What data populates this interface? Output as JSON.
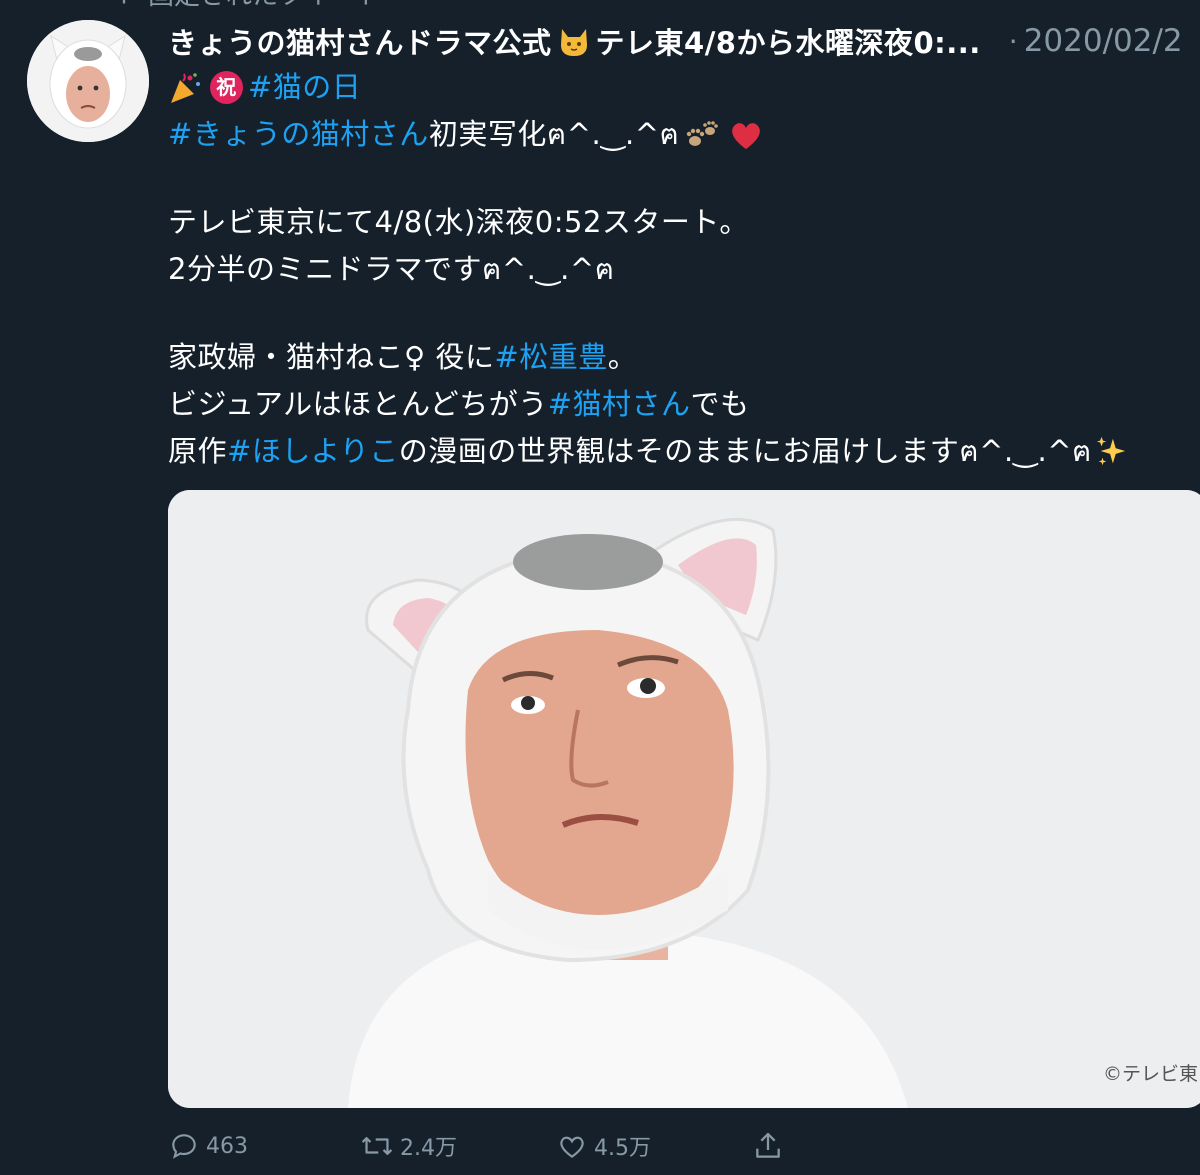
{
  "pinned_label": "固定されたツイート",
  "tweet": {
    "display_name": "きょうの猫村さんドラマ公式",
    "display_name_rest": "テレ東4/8から水曜深夜0:...",
    "separator": "·",
    "date": "2020/02/2",
    "lines": {
      "l1_badge": "祝",
      "l1_tag": "#猫の日",
      "l2_tag": "#きょうの猫村さん",
      "l2_text": " 初実写化ฅ^.‿.^ฅ",
      "l3": "テレビ東京にて4/8(水)深夜0:52スタート。",
      "l4": "2分半のミニドラマですฅ^.‿.^ฅ",
      "l5_text": "家政婦・猫村ねこ♀ 役に ",
      "l5_tag": "#松重豊",
      "l5_end": "。",
      "l6_text": "ビジュアルはほとんどちがう ",
      "l6_tag": "#猫村さん",
      "l6_end": " でも",
      "l7_text": "原作 ",
      "l7_tag": "#ほしよりこ",
      "l7_end": " の漫画の世界観はそのままにお届けしますฅ^.‿.^ฅ"
    },
    "media_credit": "©テレビ東",
    "actions": {
      "reply_count": "463",
      "retweet_count": "2.4万",
      "like_count": "4.5万"
    }
  },
  "colors": {
    "background": "#15202b",
    "link": "#1da1f2",
    "muted": "#8899a6",
    "badge": "#e0245e"
  },
  "icons": [
    "pin-icon",
    "cat-face-emoji",
    "confetti-emoji",
    "paw-prints-emoji",
    "red-heart-emoji",
    "sparkles-emoji",
    "reply-icon",
    "retweet-icon",
    "like-icon",
    "share-icon"
  ]
}
